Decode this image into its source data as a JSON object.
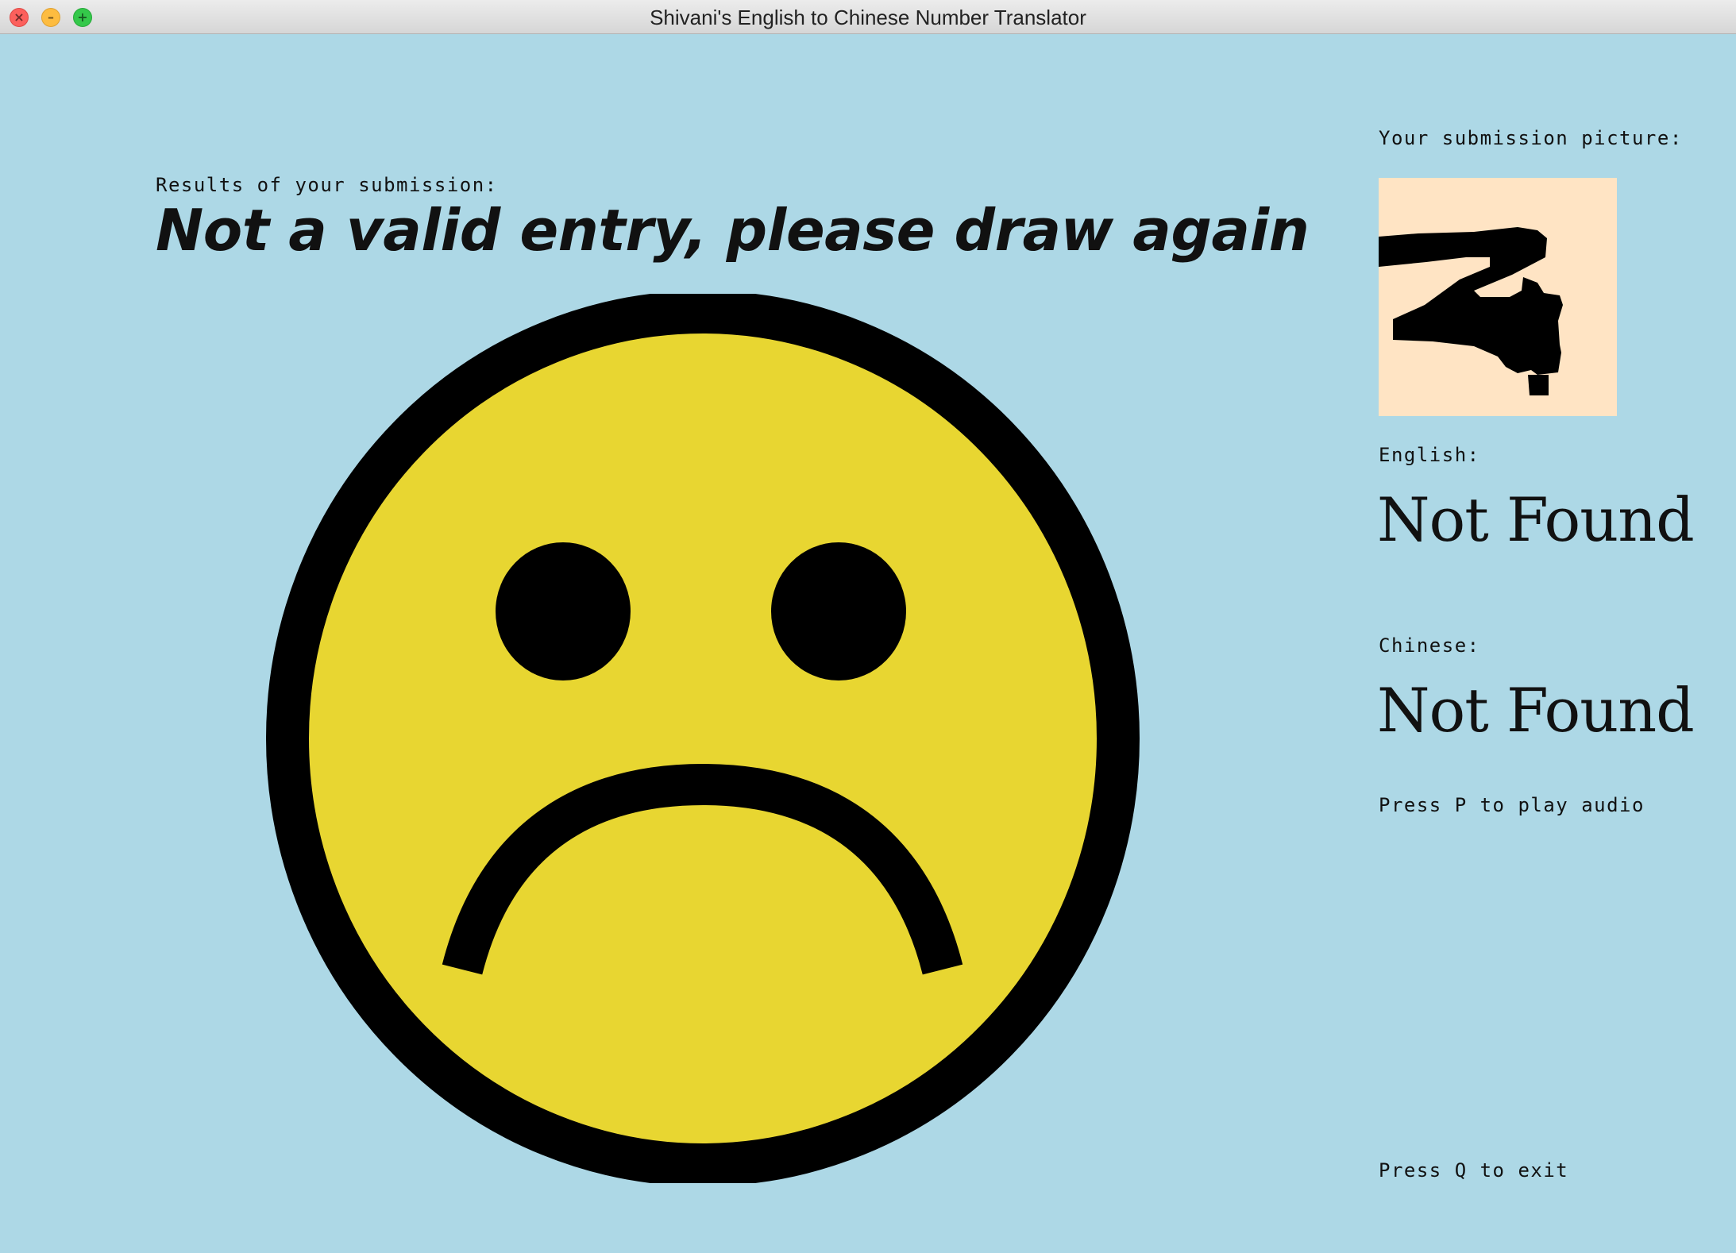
{
  "window": {
    "title": "Shivani's English to Chinese Number Translator",
    "close_glyph": "×",
    "minimize_glyph": "–",
    "maximize_glyph": "+"
  },
  "results": {
    "label": "Results of your submission:",
    "message": "Not a valid entry, please draw again"
  },
  "face": {
    "icon": "sad-face-icon",
    "fill": "#e8d631",
    "stroke": "#000000"
  },
  "sidebar": {
    "picture_label": "Your submission picture:",
    "picture_bg": "#ffe4c4",
    "english_label": "English:",
    "english_value": "Not Found",
    "chinese_label": "Chinese:",
    "chinese_value": "Not Found",
    "audio_hint": "Press P to play audio",
    "exit_hint": "Press Q to exit"
  },
  "colors": {
    "background": "#add8e6"
  }
}
